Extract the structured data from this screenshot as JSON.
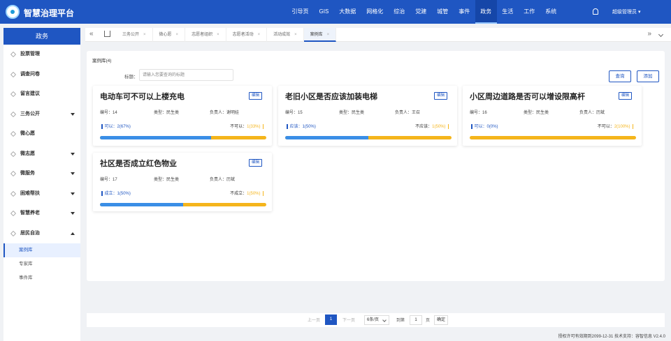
{
  "header": {
    "brand": "智慧治理平台",
    "nav": [
      "引导页",
      "GIS",
      "大数据",
      "网格化",
      "综治",
      "党建",
      "城管",
      "事件",
      "政务",
      "生活",
      "工作",
      "系统"
    ],
    "active_nav": "政务",
    "user": "超级管理员 ▾"
  },
  "sidebar": {
    "title": "政务",
    "items": [
      {
        "label": "投票管理",
        "expandable": false
      },
      {
        "label": "调查问卷",
        "expandable": false
      },
      {
        "label": "留言建议",
        "expandable": false
      },
      {
        "label": "三务公开",
        "expandable": true
      },
      {
        "label": "微心愿",
        "expandable": false
      },
      {
        "label": "微志愿",
        "expandable": true
      },
      {
        "label": "微服务",
        "expandable": true
      },
      {
        "label": "困难帮扶",
        "expandable": true
      },
      {
        "label": "智慧养老",
        "expandable": true
      },
      {
        "label": "居民自治",
        "expandable": true,
        "expanded": true
      }
    ],
    "subitems": [
      "案例库",
      "专家库",
      "事件库"
    ],
    "active_sub": "案例库"
  },
  "tabs": {
    "items": [
      "三务公开",
      "微心愿",
      "志愿者组织",
      "志愿者活动",
      "活动成效",
      "案例库"
    ],
    "active": "案例库",
    "close": "×"
  },
  "panel": {
    "title": "案例库(4)",
    "search_label": "标题：",
    "search_placeholder": "请输入您要查询的标题",
    "query_btn": "查询",
    "add_btn": "添加"
  },
  "cards": [
    {
      "title": "电动车可不可以上楼充电",
      "edit": "编辑",
      "no": "编号：14",
      "type": "类型：民生类",
      "owner": "负责人：谢明娃",
      "yes_label": "可以：",
      "yes_val": "2(67%)",
      "no_label": "不可以：",
      "no_val": "1(33%)",
      "ratio": 0.67
    },
    {
      "title": "老旧小区是否应该加装电梯",
      "edit": "编辑",
      "no": "编号：15",
      "type": "类型：民生类",
      "owner": "负责人：王召",
      "yes_label": "应该：",
      "yes_val": "1(50%)",
      "no_label": "不应该：",
      "no_val": "1(50%)",
      "ratio": 0.5
    },
    {
      "title": "小区周边道路是否可以增设限高杆",
      "edit": "编辑",
      "no": "编号：16",
      "type": "类型：民生类",
      "owner": "负责人：历斌",
      "yes_label": "可以：",
      "yes_val": "0(0%)",
      "no_label": "不可以：",
      "no_val": "2(100%)",
      "ratio": 0.0
    },
    {
      "title": "社区是否成立红色物业",
      "edit": "编辑",
      "no": "编号：17",
      "type": "类型：民生类",
      "owner": "负责人：历斌",
      "yes_label": "成立：",
      "yes_val": "1(50%)",
      "no_label": "不成立：",
      "no_val": "1(50%)",
      "ratio": 0.5
    }
  ],
  "pager": {
    "prev": "上一页",
    "page": "1",
    "next": "下一页",
    "size": "6条/页",
    "goto_label": "到第",
    "goto_val": "1",
    "page_unit": "页",
    "ok": "确定"
  },
  "footer": "授权许可有效期到2099-12-31 技术支持：容智信息 V2.4.0",
  "colors": {
    "primary": "#1f56c2",
    "blue_bar": "#3a8ee6",
    "yellow_bar": "#f5b51b"
  }
}
